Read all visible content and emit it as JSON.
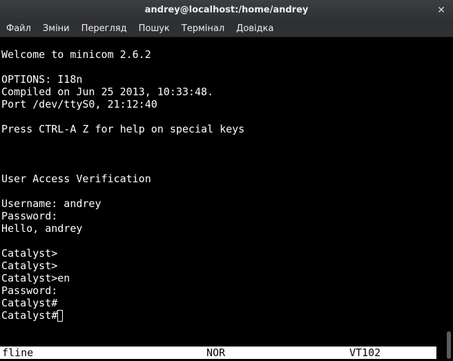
{
  "window": {
    "title": "andrey@localhost:/home/andrey",
    "close_glyph": "✕"
  },
  "menu": {
    "items": [
      "Файл",
      "Зміни",
      "Перегляд",
      "Пошук",
      "Термінал",
      "Довідка"
    ]
  },
  "terminal": {
    "lines": [
      "Welcome to minicom 2.6.2",
      "",
      "OPTIONS: I18n",
      "Compiled on Jun 25 2013, 10:33:48.",
      "Port /dev/ttyS0, 21:12:40",
      "",
      "Press CTRL-A Z for help on special keys",
      "",
      "",
      "",
      "User Access Verification",
      "",
      "Username: andrey",
      "Password:",
      "Hello, andrey",
      "",
      "Catalyst>",
      "Catalyst>",
      "Catalyst>en",
      "Password:",
      "Catalyst#",
      "Catalyst#"
    ]
  },
  "statusbar": {
    "left": "fline",
    "mode": "NOR",
    "emulation": "VT102"
  }
}
